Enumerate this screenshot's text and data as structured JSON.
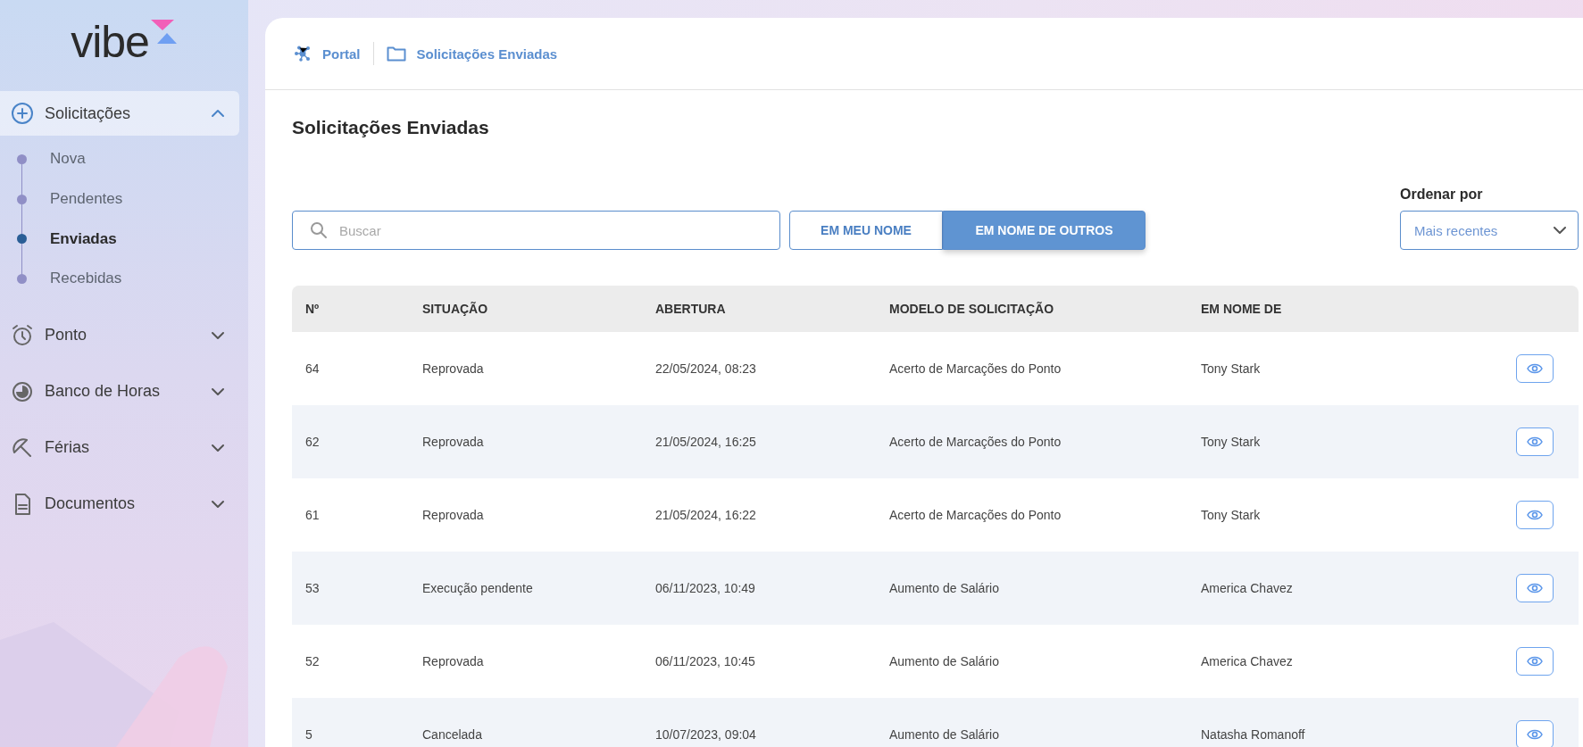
{
  "sidebar": {
    "logo": "vibe",
    "items": [
      {
        "label": "Solicitações",
        "expanded": true,
        "children": [
          {
            "label": "Nova",
            "selected": false
          },
          {
            "label": "Pendentes",
            "selected": false
          },
          {
            "label": "Enviadas",
            "selected": true
          },
          {
            "label": "Recebidas",
            "selected": false
          }
        ]
      },
      {
        "label": "Ponto",
        "expanded": false
      },
      {
        "label": "Banco de Horas",
        "expanded": false
      },
      {
        "label": "Férias",
        "expanded": false
      },
      {
        "label": "Documentos",
        "expanded": false
      }
    ]
  },
  "breadcrumb": [
    "Portal",
    "Solicitações Enviadas"
  ],
  "page_title": "Solicitações Enviadas",
  "search": {
    "placeholder": "Buscar"
  },
  "toggle": [
    {
      "label": "EM MEU NOME",
      "selected": false
    },
    {
      "label": "EM NOME DE OUTROS",
      "selected": true
    }
  ],
  "sort": {
    "label": "Ordenar por",
    "value": "Mais recentes"
  },
  "table": {
    "columns": [
      "Nº",
      "SITUAÇÃO",
      "ABERTURA",
      "MODELO DE SOLICITAÇÃO",
      "EM NOME DE"
    ],
    "rows": [
      [
        "64",
        "Reprovada",
        "22/05/2024, 08:23",
        "Acerto de Marcações do Ponto",
        "Tony Stark"
      ],
      [
        "62",
        "Reprovada",
        "21/05/2024, 16:25",
        "Acerto de Marcações do Ponto",
        "Tony Stark"
      ],
      [
        "61",
        "Reprovada",
        "21/05/2024, 16:22",
        "Acerto de Marcações do Ponto",
        "Tony Stark"
      ],
      [
        "53",
        "Execução pendente",
        "06/11/2023, 10:49",
        "Aumento de Salário",
        "America Chavez"
      ],
      [
        "52",
        "Reprovada",
        "06/11/2023, 10:45",
        "Aumento de Salário",
        "America Chavez"
      ],
      [
        "5",
        "Cancelada",
        "10/07/2023, 09:04",
        "Aumento de Salário",
        "Natasha Romanoff"
      ]
    ]
  }
}
